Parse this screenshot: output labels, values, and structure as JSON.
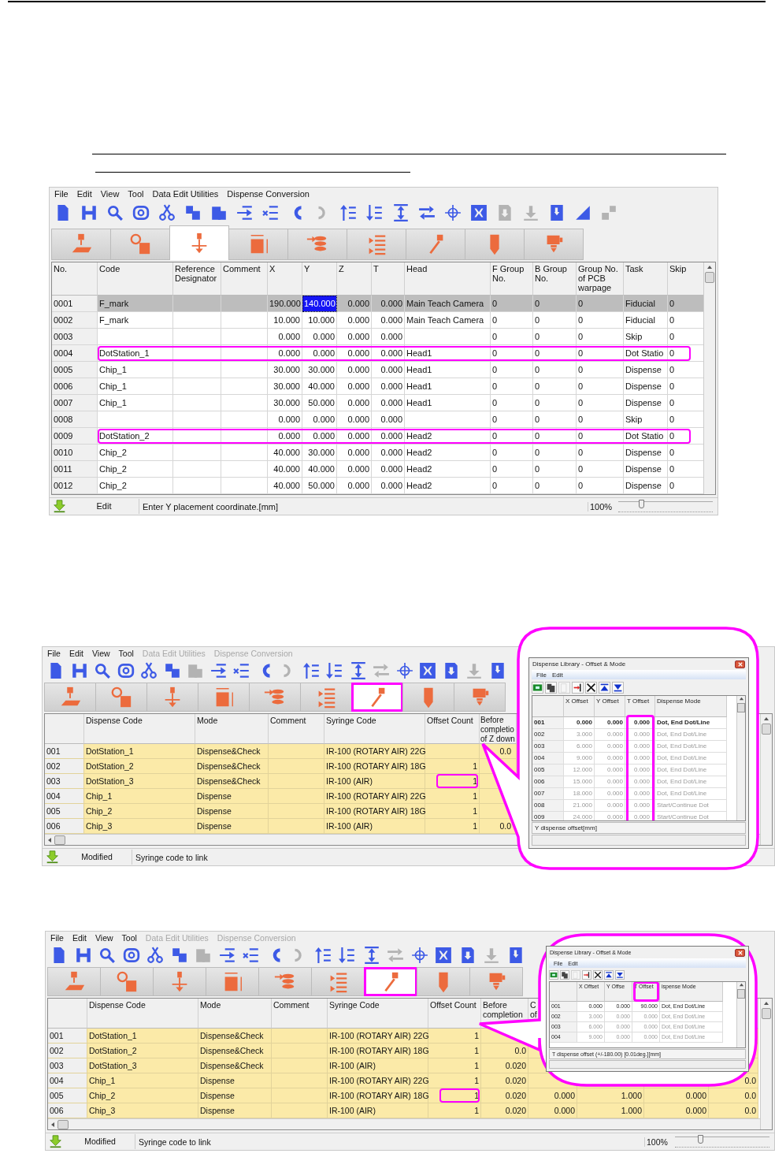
{
  "screens": [
    {
      "menu": [
        {
          "label": "File",
          "disabled": false
        },
        {
          "label": "Edit",
          "disabled": false
        },
        {
          "label": "View",
          "disabled": false
        },
        {
          "label": "Tool",
          "disabled": false
        },
        {
          "label": "Data Edit Utilities",
          "disabled": false
        },
        {
          "label": "Dispense Conversion",
          "disabled": false
        }
      ],
      "toolbar": [
        {
          "disabled": false
        },
        {
          "disabled": false
        },
        {
          "disabled": false
        },
        {
          "disabled": false
        },
        {
          "disabled": false
        },
        {
          "disabled": false
        },
        {
          "disabled": false
        },
        {
          "disabled": false
        },
        {
          "disabled": false
        },
        {
          "disabled": false
        },
        {
          "disabled": true
        },
        {
          "disabled": false
        },
        {
          "disabled": false
        },
        {
          "disabled": false
        },
        {
          "disabled": false
        },
        {
          "disabled": false
        },
        {
          "disabled": false
        },
        {
          "disabled": true
        },
        {
          "disabled": true
        },
        {
          "disabled": false
        },
        {
          "disabled": false
        },
        {
          "disabled": true
        }
      ],
      "tabs": [
        {
          "selected": false,
          "annotated": false
        },
        {
          "selected": false,
          "annotated": false
        },
        {
          "selected": true,
          "annotated": false
        },
        {
          "selected": false,
          "annotated": false
        },
        {
          "selected": false,
          "annotated": false
        },
        {
          "selected": false,
          "annotated": false
        },
        {
          "selected": false,
          "annotated": false
        },
        {
          "selected": false,
          "annotated": false
        },
        {
          "selected": false,
          "annotated": false
        }
      ],
      "table": {
        "kind": "position",
        "columns": [
          {
            "label": "No."
          },
          {
            "label": "Code"
          },
          {
            "label": "Reference Designator"
          },
          {
            "label": "Comment"
          },
          {
            "label": "X"
          },
          {
            "label": "Y"
          },
          {
            "label": "Z"
          },
          {
            "label": "T"
          },
          {
            "label": "Head"
          },
          {
            "label": "F Group No."
          },
          {
            "label": "B Group No."
          },
          {
            "label": "Group No. of PCB warpage"
          },
          {
            "label": "Task"
          },
          {
            "label": "Skip"
          }
        ],
        "rows": [
          {
            "selected": true,
            "annotated": false,
            "cells": [
              {
                "text": "0001"
              },
              {
                "text": "F_mark"
              },
              {},
              {},
              {
                "text": "190.000"
              },
              {
                "text": "140.000",
                "current": true
              },
              {
                "text": "0.000"
              },
              {
                "text": "0.000"
              },
              {
                "text": "Main Teach Camera"
              },
              {
                "text": "0"
              },
              {
                "text": "0"
              },
              {
                "text": "0"
              },
              {
                "text": "Fiducial"
              },
              {
                "text": "0"
              }
            ]
          },
          {
            "selected": false,
            "annotated": false,
            "cells": [
              {
                "text": "0002"
              },
              {
                "text": "F_mark"
              },
              {},
              {},
              {
                "text": "10.000"
              },
              {
                "text": "10.000"
              },
              {
                "text": "0.000"
              },
              {
                "text": "0.000"
              },
              {
                "text": "Main Teach Camera"
              },
              {
                "text": "0"
              },
              {
                "text": "0"
              },
              {
                "text": "0"
              },
              {
                "text": "Fiducial"
              },
              {
                "text": "0"
              }
            ]
          },
          {
            "selected": false,
            "annotated": false,
            "cells": [
              {
                "text": "0003"
              },
              {},
              {},
              {},
              {
                "text": "0.000"
              },
              {
                "text": "0.000"
              },
              {
                "text": "0.000"
              },
              {
                "text": "0.000"
              },
              {},
              {
                "text": "0"
              },
              {
                "text": "0"
              },
              {
                "text": "0"
              },
              {
                "text": "Skip"
              },
              {
                "text": "0"
              }
            ]
          },
          {
            "selected": false,
            "annotated": true,
            "cells": [
              {
                "text": "0004"
              },
              {
                "text": "DotStation_1"
              },
              {},
              {},
              {
                "text": "0.000"
              },
              {
                "text": "0.000"
              },
              {
                "text": "0.000"
              },
              {
                "text": "0.000"
              },
              {
                "text": "Head1"
              },
              {
                "text": "0"
              },
              {
                "text": "0"
              },
              {
                "text": "0"
              },
              {
                "text": "Dot Statio"
              },
              {
                "text": "0"
              }
            ]
          },
          {
            "selected": false,
            "annotated": false,
            "cells": [
              {
                "text": "0005"
              },
              {
                "text": "Chip_1"
              },
              {},
              {},
              {
                "text": "30.000"
              },
              {
                "text": "30.000"
              },
              {
                "text": "0.000"
              },
              {
                "text": "0.000"
              },
              {
                "text": "Head1"
              },
              {
                "text": "0"
              },
              {
                "text": "0"
              },
              {
                "text": "0"
              },
              {
                "text": "Dispense"
              },
              {
                "text": "0"
              }
            ]
          },
          {
            "selected": false,
            "annotated": false,
            "cells": [
              {
                "text": "0006"
              },
              {
                "text": "Chip_1"
              },
              {},
              {},
              {
                "text": "30.000"
              },
              {
                "text": "40.000"
              },
              {
                "text": "0.000"
              },
              {
                "text": "0.000"
              },
              {
                "text": "Head1"
              },
              {
                "text": "0"
              },
              {
                "text": "0"
              },
              {
                "text": "0"
              },
              {
                "text": "Dispense"
              },
              {
                "text": "0"
              }
            ]
          },
          {
            "selected": false,
            "annotated": false,
            "cells": [
              {
                "text": "0007"
              },
              {
                "text": "Chip_1"
              },
              {},
              {},
              {
                "text": "30.000"
              },
              {
                "text": "50.000"
              },
              {
                "text": "0.000"
              },
              {
                "text": "0.000"
              },
              {
                "text": "Head1"
              },
              {
                "text": "0"
              },
              {
                "text": "0"
              },
              {
                "text": "0"
              },
              {
                "text": "Dispense"
              },
              {
                "text": "0"
              }
            ]
          },
          {
            "selected": false,
            "annotated": false,
            "cells": [
              {
                "text": "0008"
              },
              {},
              {},
              {},
              {
                "text": "0.000"
              },
              {
                "text": "0.000"
              },
              {
                "text": "0.000"
              },
              {
                "text": "0.000"
              },
              {},
              {
                "text": "0"
              },
              {
                "text": "0"
              },
              {
                "text": "0"
              },
              {
                "text": "Skip"
              },
              {
                "text": "0"
              }
            ]
          },
          {
            "selected": false,
            "annotated": true,
            "cells": [
              {
                "text": "0009"
              },
              {
                "text": "DotStation_2"
              },
              {},
              {},
              {
                "text": "0.000"
              },
              {
                "text": "0.000"
              },
              {
                "text": "0.000"
              },
              {
                "text": "0.000"
              },
              {
                "text": "Head2"
              },
              {
                "text": "0"
              },
              {
                "text": "0"
              },
              {
                "text": "0"
              },
              {
                "text": "Dot Statio"
              },
              {
                "text": "0"
              }
            ]
          },
          {
            "selected": false,
            "annotated": false,
            "cells": [
              {
                "text": "0010"
              },
              {
                "text": "Chip_2"
              },
              {},
              {},
              {
                "text": "40.000"
              },
              {
                "text": "30.000"
              },
              {
                "text": "0.000"
              },
              {
                "text": "0.000"
              },
              {
                "text": "Head2"
              },
              {
                "text": "0"
              },
              {
                "text": "0"
              },
              {
                "text": "0"
              },
              {
                "text": "Dispense"
              },
              {
                "text": "0"
              }
            ]
          },
          {
            "selected": false,
            "annotated": false,
            "cells": [
              {
                "text": "0011"
              },
              {
                "text": "Chip_2"
              },
              {},
              {},
              {
                "text": "40.000"
              },
              {
                "text": "40.000"
              },
              {
                "text": "0.000"
              },
              {
                "text": "0.000"
              },
              {
                "text": "Head2"
              },
              {
                "text": "0"
              },
              {
                "text": "0"
              },
              {
                "text": "0"
              },
              {
                "text": "Dispense"
              },
              {
                "text": "0"
              }
            ]
          },
          {
            "selected": false,
            "annotated": false,
            "cells": [
              {
                "text": "0012"
              },
              {
                "text": "Chip_2"
              },
              {},
              {},
              {
                "text": "40.000"
              },
              {
                "text": "50.000"
              },
              {
                "text": "0.000"
              },
              {
                "text": "0.000"
              },
              {
                "text": "Head2"
              },
              {
                "text": "0"
              },
              {
                "text": "0"
              },
              {
                "text": "0"
              },
              {
                "text": "Dispense"
              },
              {
                "text": "0"
              }
            ]
          }
        ]
      },
      "status": {
        "state": "Edit",
        "message": "Enter Y placement coordinate.[mm]",
        "zoom": "100%",
        "level": 0.22
      }
    },
    {
      "menu": [
        {
          "label": "File",
          "disabled": false
        },
        {
          "label": "Edit",
          "disabled": false
        },
        {
          "label": "View",
          "disabled": false
        },
        {
          "label": "Tool",
          "disabled": false
        },
        {
          "label": "Data Edit Utilities",
          "disabled": true
        },
        {
          "label": "Dispense Conversion",
          "disabled": true
        }
      ],
      "toolbar": [
        {
          "disabled": false
        },
        {
          "disabled": false
        },
        {
          "disabled": false
        },
        {
          "disabled": false
        },
        {
          "disabled": false
        },
        {
          "disabled": false
        },
        {
          "disabled": true
        },
        {
          "disabled": false
        },
        {
          "disabled": false
        },
        {
          "disabled": false
        },
        {
          "disabled": true
        },
        {
          "disabled": false
        },
        {
          "disabled": false
        },
        {
          "disabled": false
        },
        {
          "disabled": true
        },
        {
          "disabled": false
        },
        {
          "disabled": false
        },
        {
          "disabled": false
        },
        {
          "disabled": true
        },
        {
          "disabled": false
        }
      ],
      "tabs": [
        {
          "selected": false,
          "annotated": false
        },
        {
          "selected": false,
          "annotated": false
        },
        {
          "selected": false,
          "annotated": false
        },
        {
          "selected": false,
          "annotated": false
        },
        {
          "selected": false,
          "annotated": false
        },
        {
          "selected": false,
          "annotated": false
        },
        {
          "selected": true,
          "annotated": true
        },
        {
          "selected": false,
          "annotated": false
        },
        {
          "selected": false,
          "annotated": false
        }
      ],
      "table": {
        "kind": "dispense",
        "columns": [
          {},
          {
            "label": "Dispense Code"
          },
          {
            "label": "Mode"
          },
          {
            "label": "Comment"
          },
          {
            "label": "Syringe Code"
          },
          {
            "label": "Offset Count"
          },
          {
            "label": "Before completio of Z down"
          }
        ],
        "rows": [
          {
            "cells": [
              {
                "text": "001"
              },
              {
                "text": "DotStation_1"
              },
              {
                "text": "Dispense&Check"
              },
              {},
              {
                "text": "IR-100 (ROTARY AIR) 22G"
              },
              {},
              {
                "text": "0.0"
              }
            ]
          },
          {
            "cells": [
              {
                "text": "002"
              },
              {
                "text": "DotStation_2"
              },
              {
                "text": "Dispense&Check"
              },
              {},
              {
                "text": "IR-100 (ROTARY AIR) 18G"
              },
              {
                "text": "1"
              },
              {}
            ]
          },
          {
            "cells": [
              {
                "text": "003"
              },
              {
                "text": "DotStation_3"
              },
              {
                "text": "Dispense&Check"
              },
              {},
              {
                "text": "IR-100 (AIR)"
              },
              {
                "text": "1",
                "annotated": true
              },
              {}
            ]
          },
          {
            "cells": [
              {
                "text": "004"
              },
              {
                "text": "Chip_1"
              },
              {
                "text": "Dispense"
              },
              {},
              {
                "text": "IR-100 (ROTARY AIR) 22G"
              },
              {
                "text": "1"
              },
              {}
            ]
          },
          {
            "cells": [
              {
                "text": "005"
              },
              {
                "text": "Chip_2"
              },
              {
                "text": "Dispense"
              },
              {},
              {
                "text": "IR-100 (ROTARY AIR) 18G"
              },
              {
                "text": "1"
              },
              {}
            ]
          },
          {
            "cells": [
              {
                "text": "006"
              },
              {
                "text": "Chip_3"
              },
              {
                "text": "Dispense"
              },
              {},
              {
                "text": "IR-100 (AIR)"
              },
              {
                "text": "1"
              },
              {
                "text": "0.0"
              }
            ]
          }
        ]
      },
      "status": {
        "state": "Modified",
        "message": "Syringe code to link"
      },
      "callout": {
        "title": "Dispense Library - Offset & Mode",
        "menu": [
          "File",
          "Edit"
        ],
        "toolbar": [
          {
            "disabled": false
          },
          {
            "disabled": false
          },
          {
            "disabled": true
          },
          {
            "disabled": false
          },
          {
            "disabled": false
          },
          {
            "disabled": false
          },
          {
            "disabled": false
          }
        ],
        "columns": [
          {},
          {
            "label": "X Offset"
          },
          {
            "label": "Y Offset"
          },
          {
            "label": "T Offset",
            "annotated_rows": true
          },
          {
            "label": "Dispense Mode"
          }
        ],
        "rows": [
          {
            "dimmed": false,
            "cells": [
              "001",
              "0.000",
              "0.000",
              "0.000",
              "Dot, End Dot/Line"
            ]
          },
          {
            "dimmed": true,
            "cells": [
              "002",
              "3.000",
              "0.000",
              "0.000",
              "Dot, End Dot/Line"
            ]
          },
          {
            "dimmed": true,
            "cells": [
              "003",
              "6.000",
              "0.000",
              "0.000",
              "Dot, End Dot/Line"
            ]
          },
          {
            "dimmed": true,
            "cells": [
              "004",
              "9.000",
              "0.000",
              "0.000",
              "Dot, End Dot/Line"
            ]
          },
          {
            "dimmed": true,
            "cells": [
              "005",
              "12.000",
              "0.000",
              "0.000",
              "Dot, End Dot/Line"
            ]
          },
          {
            "dimmed": true,
            "cells": [
              "006",
              "15.000",
              "0.000",
              "0.000",
              "Dot, End Dot/Line"
            ]
          },
          {
            "dimmed": true,
            "cells": [
              "007",
              "18.000",
              "0.000",
              "0.000",
              "Dot, End Dot/Line"
            ]
          },
          {
            "dimmed": true,
            "cells": [
              "008",
              "21.000",
              "0.000",
              "0.000",
              "Start/Continue Dot"
            ]
          },
          {
            "dimmed": true,
            "cells": [
              "009",
              "24.000",
              "0.000",
              "0.000",
              "Start/Continue Dot"
            ]
          }
        ],
        "status": "Y dispense offset[mm]"
      }
    },
    {
      "menu": [
        {
          "label": "File",
          "disabled": false
        },
        {
          "label": "Edit",
          "disabled": false
        },
        {
          "label": "View",
          "disabled": false
        },
        {
          "label": "Tool",
          "disabled": false
        },
        {
          "label": "Data Edit Utilities",
          "disabled": true
        },
        {
          "label": "Dispense Conversion",
          "disabled": true
        }
      ],
      "toolbar": [
        {
          "disabled": false
        },
        {
          "disabled": false
        },
        {
          "disabled": false
        },
        {
          "disabled": false
        },
        {
          "disabled": false
        },
        {
          "disabled": false
        },
        {
          "disabled": true
        },
        {
          "disabled": false
        },
        {
          "disabled": false
        },
        {
          "disabled": false
        },
        {
          "disabled": true
        },
        {
          "disabled": false
        },
        {
          "disabled": false
        },
        {
          "disabled": false
        },
        {
          "disabled": true
        },
        {
          "disabled": false
        },
        {
          "disabled": false
        },
        {
          "disabled": false
        },
        {
          "disabled": true
        },
        {
          "disabled": false
        }
      ],
      "tabs": [
        {
          "selected": false,
          "annotated": false
        },
        {
          "selected": false,
          "annotated": false
        },
        {
          "selected": false,
          "annotated": false
        },
        {
          "selected": false,
          "annotated": false
        },
        {
          "selected": false,
          "annotated": false
        },
        {
          "selected": false,
          "annotated": false
        },
        {
          "selected": true,
          "annotated": true
        },
        {
          "selected": false,
          "annotated": false
        },
        {
          "selected": false,
          "annotated": false
        }
      ],
      "table": {
        "kind": "dispense",
        "columns": [
          {},
          {
            "label": "Dispense Code"
          },
          {
            "label": "Mode"
          },
          {
            "label": "Comment"
          },
          {
            "label": "Syringe Code"
          },
          {
            "label": "Offset Count"
          },
          {
            "label": "Before completion"
          },
          {
            "label": "C\nof"
          },
          {},
          {},
          {}
        ],
        "rows": [
          {
            "cells": [
              {
                "text": "001"
              },
              {
                "text": "DotStation_1"
              },
              {
                "text": "Dispense&Check"
              },
              {},
              {
                "text": "IR-100 (ROTARY AIR) 22G"
              },
              {
                "text": "1"
              },
              {},
              {},
              {},
              {},
              {}
            ]
          },
          {
            "cells": [
              {
                "text": "002"
              },
              {
                "text": "DotStation_2"
              },
              {
                "text": "Dispense&Check"
              },
              {},
              {
                "text": "IR-100 (ROTARY AIR) 18G"
              },
              {
                "text": "1"
              },
              {
                "text": "0.0"
              },
              {},
              {},
              {},
              {}
            ]
          },
          {
            "cells": [
              {
                "text": "003"
              },
              {
                "text": "DotStation_3"
              },
              {
                "text": "Dispense&Check"
              },
              {},
              {
                "text": "IR-100 (AIR)"
              },
              {
                "text": "1"
              },
              {
                "text": "0.020"
              },
              {},
              {},
              {},
              {}
            ]
          },
          {
            "cells": [
              {
                "text": "004"
              },
              {
                "text": "Chip_1"
              },
              {
                "text": "Dispense"
              },
              {},
              {
                "text": "IR-100 (ROTARY AIR) 22G"
              },
              {
                "text": "1"
              },
              {
                "text": "0.020"
              },
              {},
              {},
              {},
              {
                "text": "0.0"
              }
            ]
          },
          {
            "cells": [
              {
                "text": "005"
              },
              {
                "text": "Chip_2"
              },
              {
                "text": "Dispense"
              },
              {},
              {
                "text": "IR-100 (ROTARY AIR) 18G"
              },
              {
                "text": "1",
                "annotated": true
              },
              {
                "text": "0.020"
              },
              {
                "text": "0.000"
              },
              {
                "text": "1.000"
              },
              {
                "text": "0.000"
              },
              {
                "text": "0.0"
              }
            ]
          },
          {
            "cells": [
              {
                "text": "006"
              },
              {
                "text": "Chip_3"
              },
              {
                "text": "Dispense"
              },
              {},
              {
                "text": "IR-100 (AIR)"
              },
              {
                "text": "1"
              },
              {
                "text": "0.020"
              },
              {
                "text": "0.000"
              },
              {
                "text": "1.000"
              },
              {
                "text": "0.000"
              },
              {
                "text": "0.0"
              }
            ]
          }
        ]
      },
      "status": {
        "state": "Modified",
        "message": "Syringe code to link",
        "zoom": "100%",
        "level": 0.24
      },
      "callout": {
        "title": "Dispense Library - Offset & Mode",
        "menu": [
          "File",
          "Edit"
        ],
        "toolbar": [
          {
            "disabled": false
          },
          {
            "disabled": false
          },
          {
            "disabled": true
          },
          {
            "disabled": false
          },
          {
            "disabled": false
          },
          {
            "disabled": false
          },
          {
            "disabled": false
          }
        ],
        "columns": [
          {},
          {
            "label": "X Offset"
          },
          {
            "label": "Y Offse"
          },
          {
            "label": "T Offset",
            "annotated_header": true
          },
          {
            "label": "ispense Mode"
          }
        ],
        "rows": [
          {
            "dimmed": false,
            "cells": [
              "001",
              "0.000",
              "0.000",
              "90.000",
              "Dot, End Dot/Line"
            ]
          },
          {
            "dimmed": true,
            "cells": [
              "002",
              "3.000",
              "0.000",
              "0.000",
              "Dot, End Dot/Line"
            ]
          },
          {
            "dimmed": true,
            "cells": [
              "003",
              "6.000",
              "0.000",
              "0.000",
              "Dot, End Dot/Line"
            ]
          },
          {
            "dimmed": true,
            "cells": [
              "004",
              "9.000",
              "0.000",
              "0.000",
              "Dot, End Dot/Line"
            ]
          }
        ],
        "status": "T dispense offset (+/-180.00) [0.01deg.][mm]"
      }
    }
  ]
}
